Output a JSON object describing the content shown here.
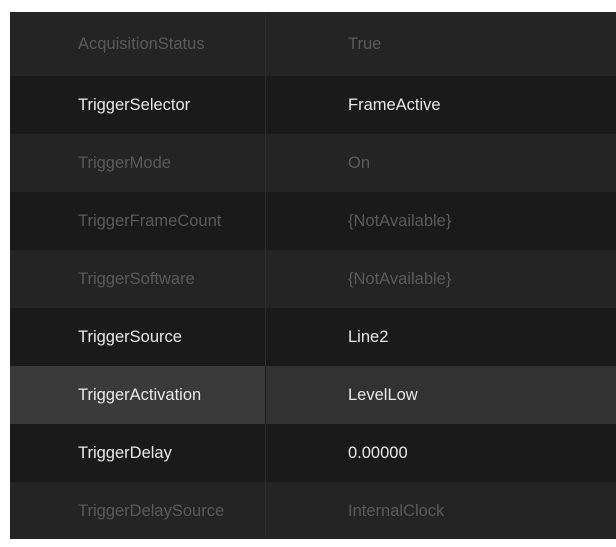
{
  "properties": [
    {
      "name": "AcquisitionStatus",
      "value": "True",
      "enabled": false
    },
    {
      "name": "TriggerSelector",
      "value": "FrameActive",
      "enabled": true
    },
    {
      "name": "TriggerMode",
      "value": "On",
      "enabled": false
    },
    {
      "name": "TriggerFrameCount",
      "value": "{NotAvailable}",
      "enabled": false
    },
    {
      "name": "TriggerSoftware",
      "value": "{NotAvailable}",
      "enabled": false
    },
    {
      "name": "TriggerSource",
      "value": "Line2",
      "enabled": true
    },
    {
      "name": "TriggerActivation",
      "value": "LevelLow",
      "enabled": true,
      "selected": true
    },
    {
      "name": "TriggerDelay",
      "value": "0.00000",
      "enabled": true
    },
    {
      "name": "TriggerDelaySource",
      "value": "InternalClock",
      "enabled": false
    }
  ]
}
